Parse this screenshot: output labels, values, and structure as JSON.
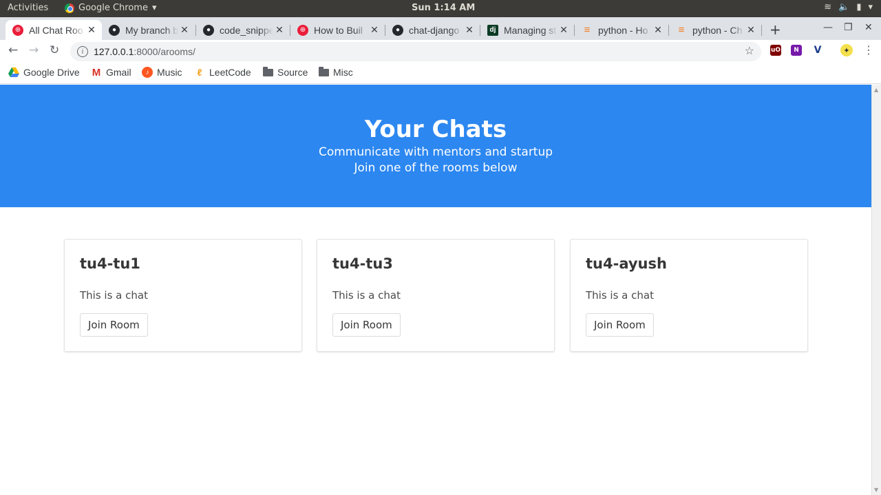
{
  "system": {
    "activities": "Activities",
    "app_name": "Google Chrome",
    "clock": "Sun  1:14 AM"
  },
  "tabs": [
    {
      "title": "All Chat Roo",
      "favicon": "red-circle-icon",
      "active": true
    },
    {
      "title": "My branch b",
      "favicon": "github-icon"
    },
    {
      "title": "code_snippe",
      "favicon": "github-icon"
    },
    {
      "title": "How to Buil",
      "favicon": "red-circle-icon"
    },
    {
      "title": "chat-django",
      "favicon": "github-icon"
    },
    {
      "title": "Managing st",
      "favicon": "django-icon"
    },
    {
      "title": "python - Ho",
      "favicon": "stackoverflow-icon"
    },
    {
      "title": "python - Ch",
      "favicon": "stackoverflow-icon"
    }
  ],
  "address_bar": {
    "host": "127.0.0.1",
    "path": ":8000/arooms/"
  },
  "bookmarks": [
    {
      "label": "Google Drive",
      "icon": "google-drive-icon"
    },
    {
      "label": "Gmail",
      "icon": "gmail-icon"
    },
    {
      "label": "Music",
      "icon": "music-icon"
    },
    {
      "label": "LeetCode",
      "icon": "leetcode-icon"
    },
    {
      "label": "Source",
      "icon": "folder-icon"
    },
    {
      "label": "Misc",
      "icon": "folder-icon"
    }
  ],
  "hero": {
    "title": "Your Chats",
    "line1": "Communicate with mentors and startup",
    "line2": "Join one of the rooms below",
    "background": "#2c87f0"
  },
  "rooms": [
    {
      "name": "tu4-tu1",
      "description": "This is a chat",
      "button": "Join Room"
    },
    {
      "name": "tu4-tu3",
      "description": "This is a chat",
      "button": "Join Room"
    },
    {
      "name": "tu4-ayush",
      "description": "This is a chat",
      "button": "Join Room"
    }
  ]
}
